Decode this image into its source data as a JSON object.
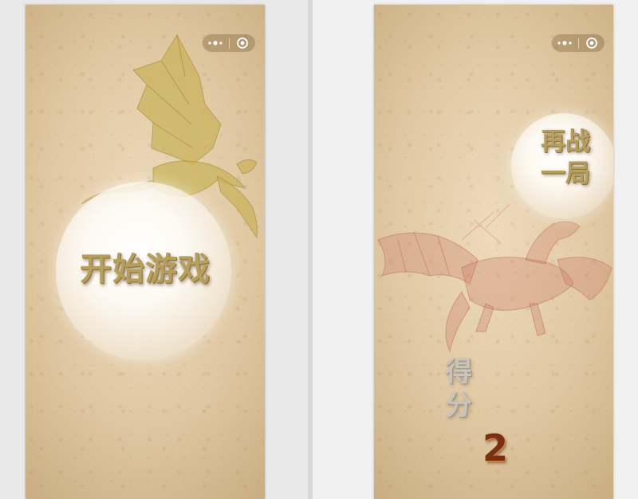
{
  "start_screen": {
    "start_button_label": "开始游戏",
    "capsule": {
      "more_icon": "more-dots-icon",
      "close_icon": "target-circle-icon"
    }
  },
  "game_over_screen": {
    "replay_button_label": "再战\n一局",
    "score_label": "得\n分",
    "score_value": "2",
    "capsule": {
      "more_icon": "more-dots-icon",
      "close_icon": "target-circle-icon"
    }
  },
  "colors": {
    "parchment": "#e2cba6",
    "gold_text": "#b59f5e",
    "score_text": "#7a2f12",
    "gray_text": "#c9c3b8",
    "red_dragon": "#c97a62",
    "gold_dragon": "#c9b35c"
  }
}
